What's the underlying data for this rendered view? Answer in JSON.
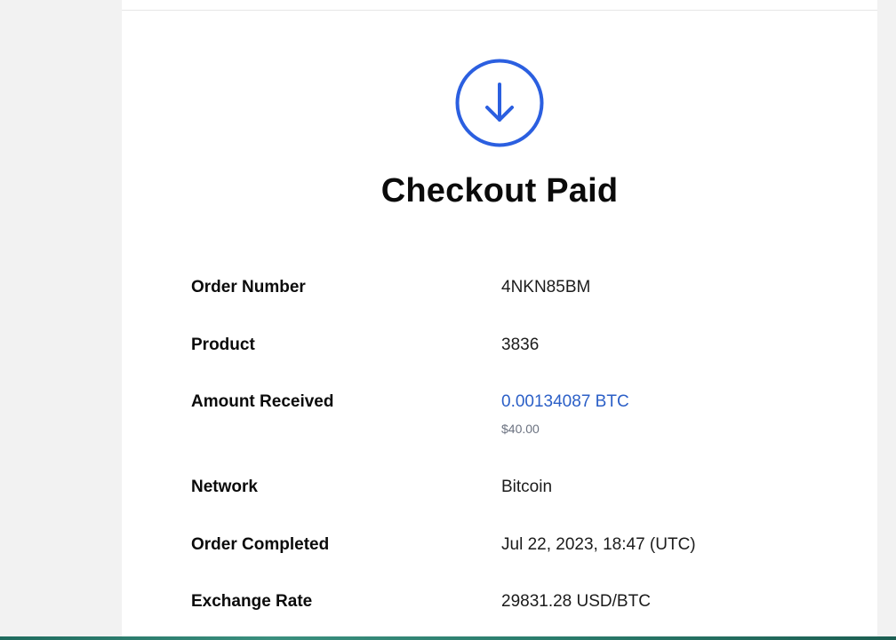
{
  "checkout": {
    "status_icon": "arrow-down-circle-icon",
    "title": "Checkout Paid",
    "accent_color": "#2b5fc7",
    "rows": [
      {
        "label": "Order Number",
        "value": "4NKN85BM"
      },
      {
        "label": "Product",
        "value": "3836"
      },
      {
        "label": "Amount Received",
        "value": "0.00134087 BTC",
        "sub_value": "$40.00"
      },
      {
        "label": "Network",
        "value": "Bitcoin"
      },
      {
        "label": "Order Completed",
        "value": "Jul 22, 2023, 18:47 (UTC)"
      },
      {
        "label": "Exchange Rate",
        "value": "29831.28 USD/BTC"
      }
    ]
  }
}
